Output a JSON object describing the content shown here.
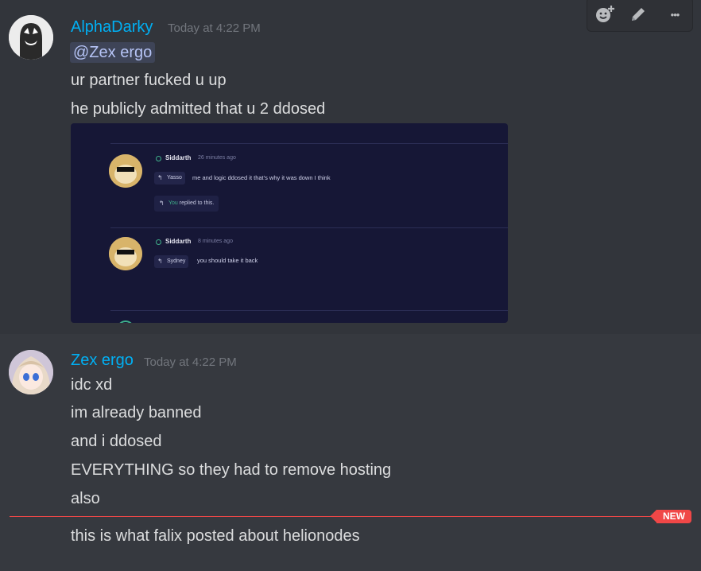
{
  "message1": {
    "author": "AlphaDarky",
    "timestamp": "Today at 4:22 PM",
    "mention": "@Zex ergo",
    "lines": [
      "ur partner fucked u up",
      "he publicly  admitted that u 2 ddosed"
    ],
    "author_color": "#00b0f4"
  },
  "toolbar": {
    "icons": [
      "add-reaction-icon",
      "edit-icon",
      "more-icon"
    ],
    "more_glyph": "•••"
  },
  "embed": {
    "message_a": {
      "author": "Siddarth",
      "time": "26 minutes ago",
      "reply_to": "Yasso",
      "text": "me and logic ddosed it that's why it was down I think",
      "replied_you": "You",
      "replied_rest": " replied to this."
    },
    "message_b": {
      "author": "Siddarth",
      "time": "8 minutes ago",
      "reply_to": "Sydney",
      "text": "you should take it back"
    },
    "background": "#161736",
    "accent": "#3fb08a"
  },
  "message2": {
    "author": "Zex ergo",
    "timestamp": "Today at 4:22 PM",
    "lines": [
      "idc xd",
      "im already banned",
      "and i ddosed",
      "EVERYTHING so they had to remove hosting",
      "also"
    ]
  },
  "new_divider": {
    "label": "NEW",
    "color": "#f04747"
  },
  "message3": {
    "text": "this is what falix posted about helionodes"
  }
}
